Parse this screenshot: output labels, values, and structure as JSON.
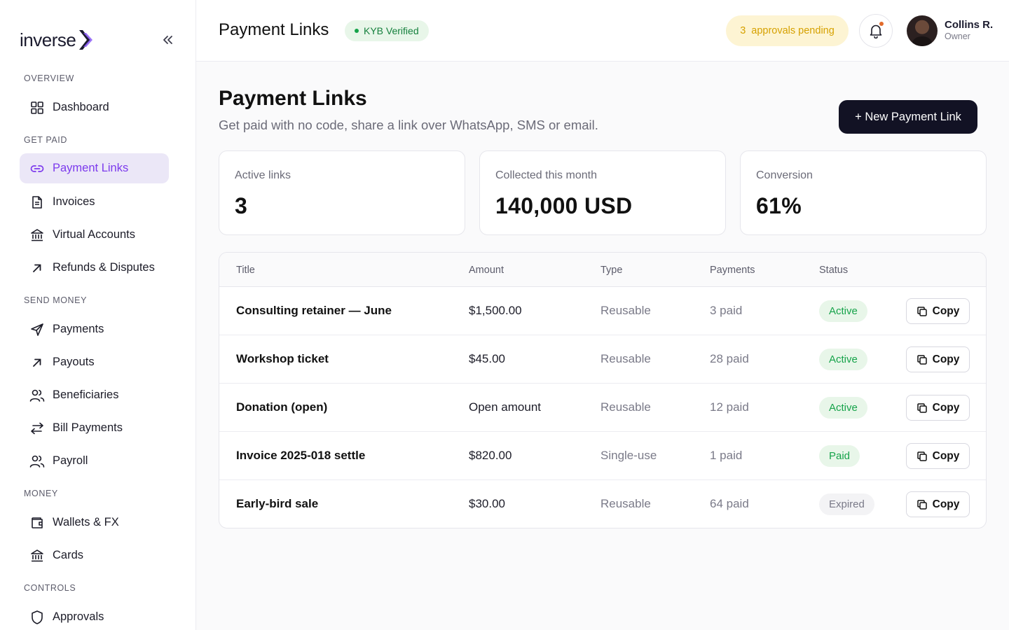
{
  "brand": {
    "logo_text": "inverse"
  },
  "sidebar": {
    "sections": [
      {
        "label": "OVERVIEW",
        "items": [
          {
            "label": "Dashboard",
            "icon": "grid-icon"
          }
        ]
      },
      {
        "label": "GET PAID",
        "items": [
          {
            "label": "Payment Links",
            "icon": "link-icon",
            "active": true
          },
          {
            "label": "Invoices",
            "icon": "document-icon"
          },
          {
            "label": "Virtual Accounts",
            "icon": "bank-icon"
          },
          {
            "label": "Refunds & Disputes",
            "icon": "arrow-up-right-icon"
          }
        ]
      },
      {
        "label": "SEND MONEY",
        "items": [
          {
            "label": "Payments",
            "icon": "send-icon"
          },
          {
            "label": "Payouts",
            "icon": "arrow-up-right-icon"
          },
          {
            "label": "Beneficiaries",
            "icon": "users-icon"
          },
          {
            "label": "Bill Payments",
            "icon": "transfer-icon"
          },
          {
            "label": "Payroll",
            "icon": "users-icon"
          }
        ]
      },
      {
        "label": "MONEY",
        "items": [
          {
            "label": "Wallets & FX",
            "icon": "wallet-icon"
          },
          {
            "label": "Cards",
            "icon": "bank-icon"
          }
        ]
      },
      {
        "label": "CONTROLS",
        "items": [
          {
            "label": "Approvals",
            "icon": "shield-icon"
          }
        ]
      }
    ]
  },
  "header": {
    "title": "Payment Links",
    "kyb_badge": "KYB Verified",
    "approvals_count": "3",
    "approvals_text": "approvals pending",
    "user_name": "Collins R.",
    "user_role": "Owner"
  },
  "main": {
    "title": "Payment Links",
    "subtitle": "Get paid with no code, share a link over WhatsApp, SMS or email.",
    "new_button": "+ New Payment Link",
    "stats": [
      {
        "label": "Active links",
        "value": "3"
      },
      {
        "label": "Collected this month",
        "value": "140,000 USD"
      },
      {
        "label": "Conversion",
        "value": "61%"
      }
    ],
    "table": {
      "headers": {
        "title": "Title",
        "amount": "Amount",
        "type": "Type",
        "payments": "Payments",
        "status": "Status"
      },
      "copy_label": "Copy",
      "rows": [
        {
          "title": "Consulting retainer — June",
          "amount": "$1,500.00",
          "type": "Reusable",
          "payments": "3 paid",
          "status": "Active",
          "status_kind": "active"
        },
        {
          "title": "Workshop ticket",
          "amount": "$45.00",
          "type": "Reusable",
          "payments": "28 paid",
          "status": "Active",
          "status_kind": "active"
        },
        {
          "title": "Donation (open)",
          "amount": "Open amount",
          "type": "Reusable",
          "payments": "12 paid",
          "status": "Active",
          "status_kind": "active"
        },
        {
          "title": "Invoice 2025-018 settle",
          "amount": "$820.00",
          "type": "Single-use",
          "payments": "1 paid",
          "status": "Paid",
          "status_kind": "paid"
        },
        {
          "title": "Early-bird sale",
          "amount": "$30.00",
          "type": "Reusable",
          "payments": "64 paid",
          "status": "Expired",
          "status_kind": "expired"
        }
      ]
    }
  },
  "colors": {
    "accent": "#7c3aed",
    "success": "#16a34a",
    "warning": "#d6a100",
    "dark": "#121224"
  }
}
